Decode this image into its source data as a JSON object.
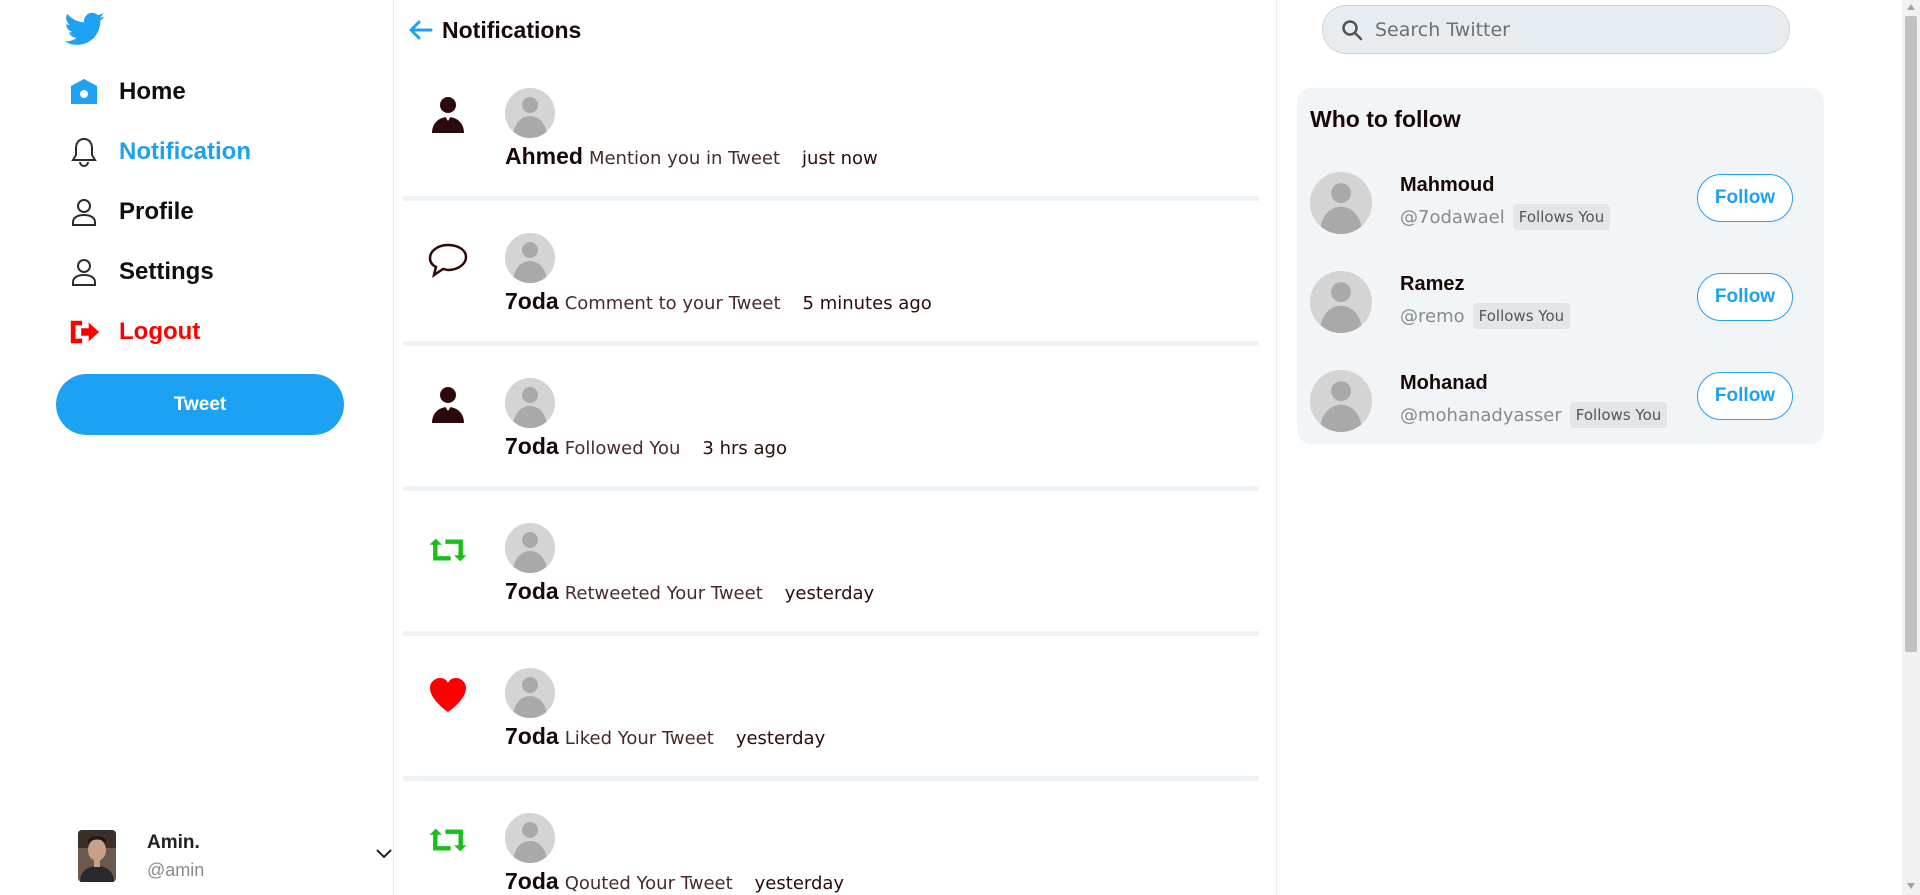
{
  "colors": {
    "accent": "#1da1f2",
    "danger": "#ff0000",
    "retweet": "#17bf17",
    "like": "#ff0000",
    "dark": "#2d0a0a"
  },
  "sidebar": {
    "items": [
      {
        "label": "Home",
        "icon": "home-icon"
      },
      {
        "label": "Notification",
        "icon": "bell-icon",
        "active": true
      },
      {
        "label": "Profile",
        "icon": "user-icon"
      },
      {
        "label": "Settings",
        "icon": "user-icon"
      },
      {
        "label": "Logout",
        "icon": "logout-icon"
      }
    ],
    "tweet_button": "Tweet",
    "account": {
      "name": "Amin.",
      "handle": "@amin"
    }
  },
  "main": {
    "title": "Notifications",
    "notifications": [
      {
        "type": "follow-person",
        "icon": "person-icon",
        "user": "Ahmed",
        "action": "Mention you in Tweet",
        "time": "just now"
      },
      {
        "type": "comment",
        "icon": "comment-icon",
        "user": "7oda",
        "action": "Comment to your Tweet",
        "time": "5 minutes ago"
      },
      {
        "type": "follow",
        "icon": "person-icon",
        "user": "7oda",
        "action": "Followed You",
        "time": "3 hrs ago"
      },
      {
        "type": "retweet",
        "icon": "retweet-icon",
        "user": "7oda",
        "action": "Retweeted Your Tweet",
        "time": "yesterday"
      },
      {
        "type": "like",
        "icon": "heart-icon",
        "user": "7oda",
        "action": "Liked Your Tweet",
        "time": "yesterday"
      },
      {
        "type": "quote",
        "icon": "retweet-icon",
        "user": "7oda",
        "action": "Qouted Your Tweet",
        "time": "yesterday"
      }
    ]
  },
  "search": {
    "placeholder": "Search Twitter"
  },
  "who_to_follow": {
    "title": "Who to follow",
    "users": [
      {
        "name": "Mahmoud",
        "handle": "@7odawael",
        "badge": "Follows You",
        "button": "Follow"
      },
      {
        "name": "Ramez",
        "handle": "@remo",
        "badge": "Follows You",
        "button": "Follow"
      },
      {
        "name": "Mohanad",
        "handle": "@mohanadyasser",
        "badge": "Follows You",
        "button": "Follow"
      }
    ]
  }
}
